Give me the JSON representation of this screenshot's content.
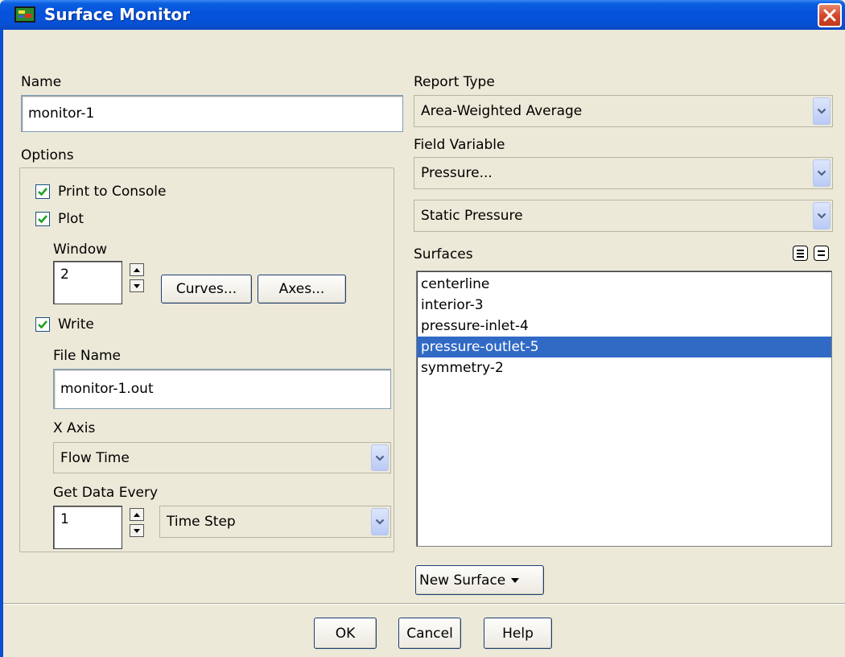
{
  "window": {
    "title": "Surface Monitor"
  },
  "name": {
    "label": "Name",
    "value": "monitor-1"
  },
  "options": {
    "label": "Options",
    "print_to_console": {
      "label": "Print to Console",
      "checked": true
    },
    "plot": {
      "label": "Plot",
      "checked": true
    },
    "window_label": "Window",
    "window_value": "2",
    "curves_button": "Curves...",
    "axes_button": "Axes...",
    "write": {
      "label": "Write",
      "checked": true
    },
    "file_name_label": "File Name",
    "file_name_value": "monitor-1.out",
    "x_axis_label": "X Axis",
    "x_axis_value": "Flow Time",
    "get_data_every_label": "Get Data Every",
    "get_data_every_value": "1",
    "get_data_every_unit": "Time Step"
  },
  "report_type": {
    "label": "Report Type",
    "value": "Area-Weighted Average"
  },
  "field_variable": {
    "label": "Field Variable",
    "category": "Pressure...",
    "value": "Static Pressure"
  },
  "surfaces": {
    "label": "Surfaces",
    "items": [
      "centerline",
      "interior-3",
      "pressure-inlet-4",
      "pressure-outlet-5",
      "symmetry-2"
    ],
    "selected_index": 3,
    "new_surface_button": "New Surface"
  },
  "buttons": {
    "ok": "OK",
    "cancel": "Cancel",
    "help": "Help"
  },
  "colors": {
    "selection": "#316ac5",
    "titlebar": "#0553dc",
    "check": "#21a121",
    "dialog_bg": "#ece9d8"
  }
}
